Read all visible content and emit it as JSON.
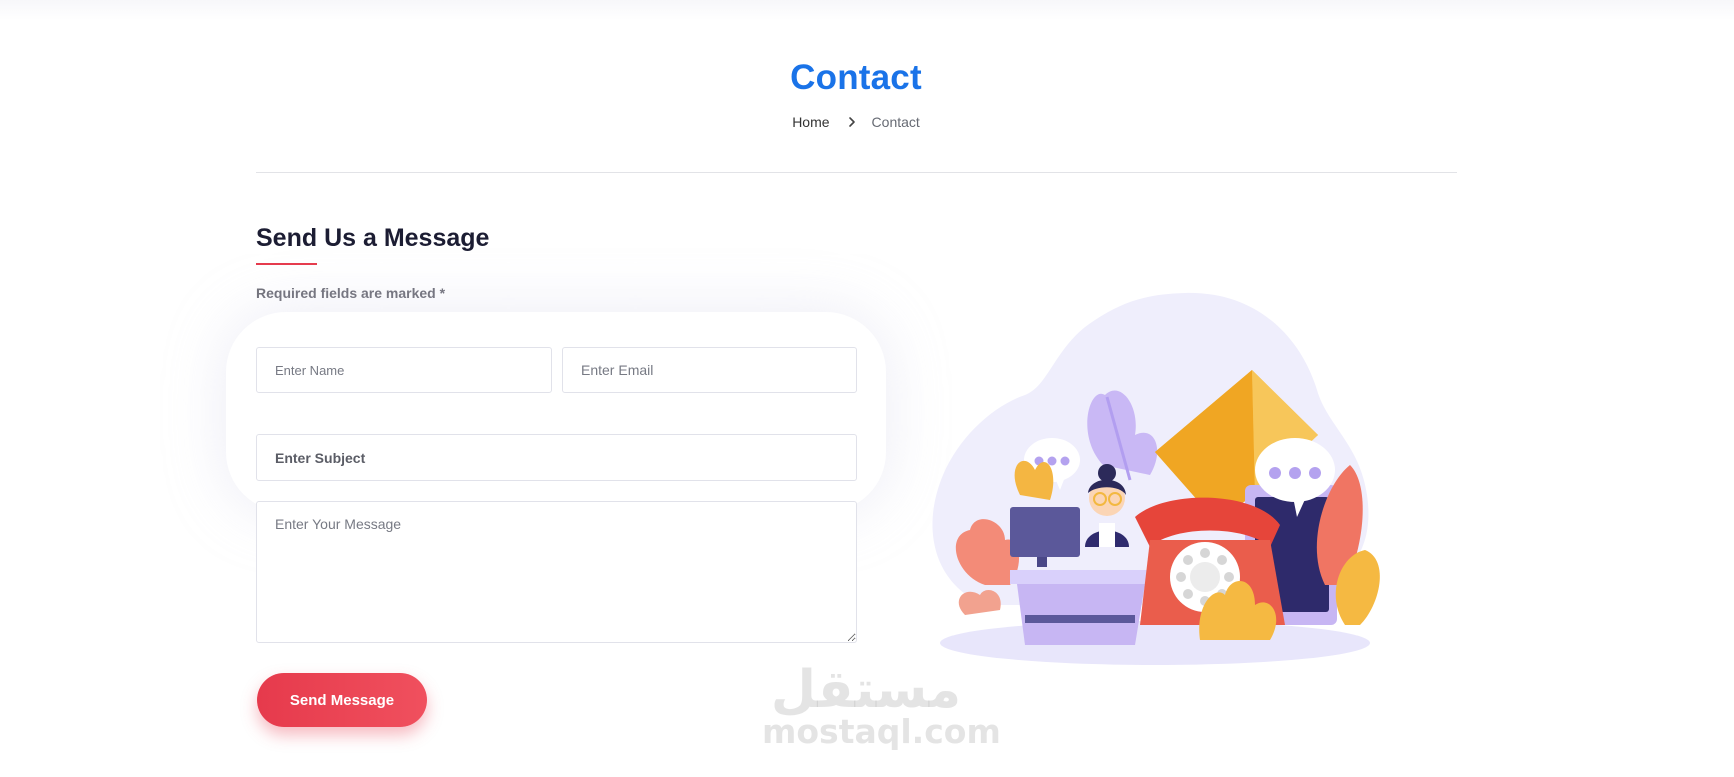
{
  "header": {
    "title": "Contact",
    "breadcrumb": {
      "home": "Home",
      "current": "Contact"
    }
  },
  "form": {
    "title": "Send Us a Message",
    "required_note": "Required fields are marked *",
    "name_placeholder": "Enter Name",
    "email_placeholder": "Enter Email",
    "subject_placeholder": "Enter Subject",
    "message_placeholder": "Enter Your Message",
    "submit_label": "Send Message"
  },
  "watermark": {
    "arabic": "مستقل",
    "latin": "mostaql.com"
  },
  "colors": {
    "title_blue": "#1a73e8",
    "accent_red": "#e63a4c",
    "heading_dark": "#1c1d33",
    "illustration_blob": "#efeefc"
  },
  "icons": {
    "breadcrumb_separator": "chevron-right-icon",
    "illustration": "contact-support-illustration"
  }
}
